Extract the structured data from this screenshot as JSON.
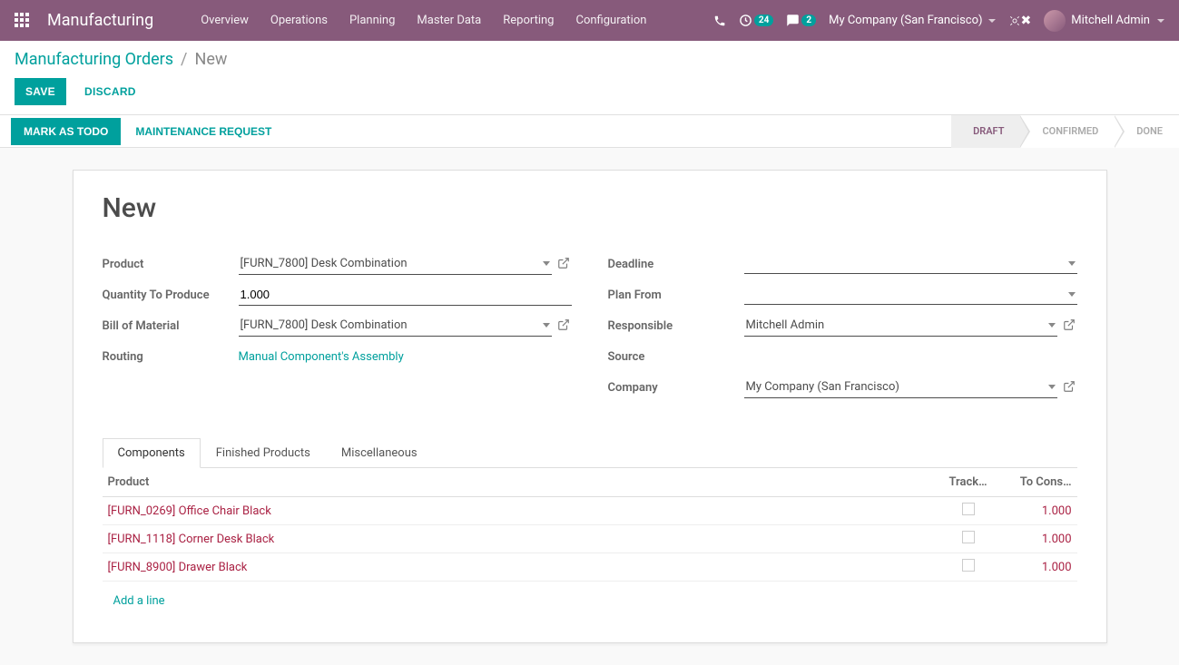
{
  "navbar": {
    "brand": "Manufacturing",
    "menu": [
      "Overview",
      "Operations",
      "Planning",
      "Master Data",
      "Reporting",
      "Configuration"
    ],
    "activity_badge": "24",
    "discuss_badge": "2",
    "company": "My Company (San Francisco)",
    "user": "Mitchell Admin"
  },
  "breadcrumb": {
    "parent": "Manufacturing Orders",
    "current": "New"
  },
  "buttons": {
    "save": "SAVE",
    "discard": "DISCARD",
    "mark_todo": "MARK AS TODO",
    "maintenance": "MAINTENANCE REQUEST"
  },
  "status": {
    "draft": "DRAFT",
    "confirmed": "CONFIRMED",
    "done": "DONE"
  },
  "form": {
    "title": "New",
    "labels": {
      "product": "Product",
      "qty": "Quantity To Produce",
      "bom": "Bill of Material",
      "routing": "Routing",
      "deadline": "Deadline",
      "plan_from": "Plan From",
      "responsible": "Responsible",
      "source": "Source",
      "company": "Company"
    },
    "values": {
      "product": "[FURN_7800] Desk Combination",
      "qty": "1.000",
      "bom": "[FURN_7800] Desk Combination",
      "routing": "Manual Component's Assembly",
      "deadline": "",
      "plan_from": "",
      "responsible": "Mitchell Admin",
      "source": "",
      "company": "My Company (San Francisco)"
    }
  },
  "tabs": {
    "components": "Components",
    "finished": "Finished Products",
    "misc": "Miscellaneous"
  },
  "components_table": {
    "headers": {
      "product": "Product",
      "tracking": "Track…",
      "to_consume": "To Cons…"
    },
    "rows": [
      {
        "product": "[FURN_0269] Office Chair Black",
        "qty": "1.000"
      },
      {
        "product": "[FURN_1118] Corner Desk Black",
        "qty": "1.000"
      },
      {
        "product": "[FURN_8900] Drawer Black",
        "qty": "1.000"
      }
    ],
    "add_line": "Add a line"
  }
}
